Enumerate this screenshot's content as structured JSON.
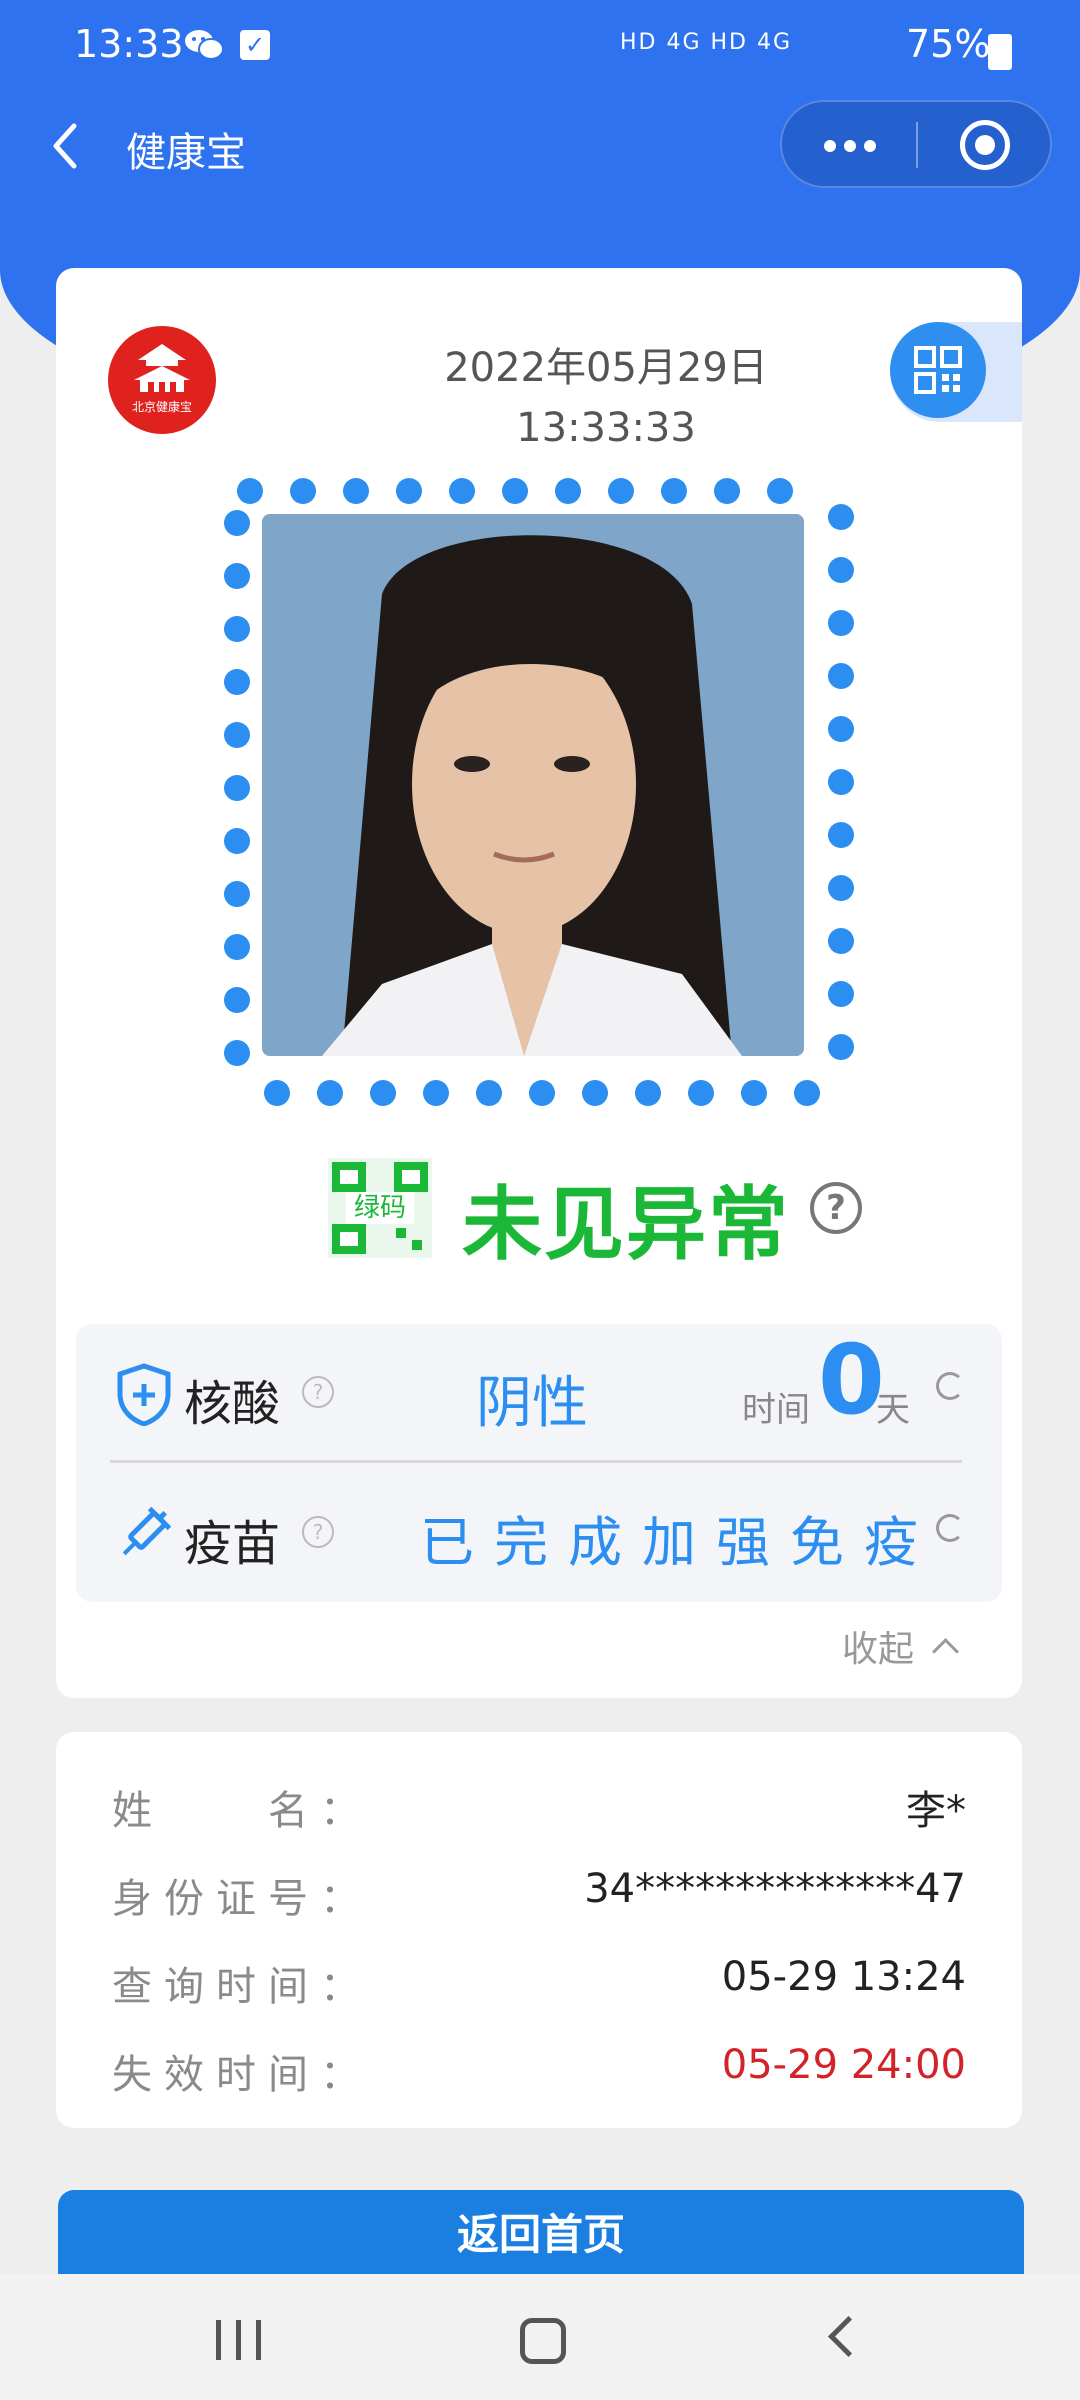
{
  "status_bar": {
    "time": "13:33",
    "network": "HD 4G HD 4G",
    "battery": "75%"
  },
  "nav": {
    "title": "健康宝",
    "icons": [
      "back-arrow-icon",
      "more-icon",
      "close-target-icon"
    ]
  },
  "card": {
    "logo_text": "北京健康宝",
    "date": "2022年05月29日",
    "time": "13:33:33",
    "code_label": "绿码",
    "status": "未见异常",
    "help_mark": "?",
    "colors": {
      "primary": "#2e72f0",
      "green": "#1bb838",
      "red": "#d2232a"
    },
    "nucleic": {
      "label": "核酸",
      "q": "?",
      "value": "阴性",
      "time_label": "时间",
      "days": "0",
      "days_unit": "天"
    },
    "vaccine": {
      "label": "疫苗",
      "q": "?",
      "value": "已完成加强免疫"
    },
    "collapse": "收起"
  },
  "info": {
    "name_label": "姓　　名：",
    "name_value": "李*",
    "id_label": "身份证号：",
    "id_value": "34**************47",
    "query_label": "查询时间：",
    "query_value": "05-29 13:24",
    "expire_label": "失效时间：",
    "expire_value": "05-29 24:00"
  },
  "actions": {
    "home_button": "返回首页"
  }
}
